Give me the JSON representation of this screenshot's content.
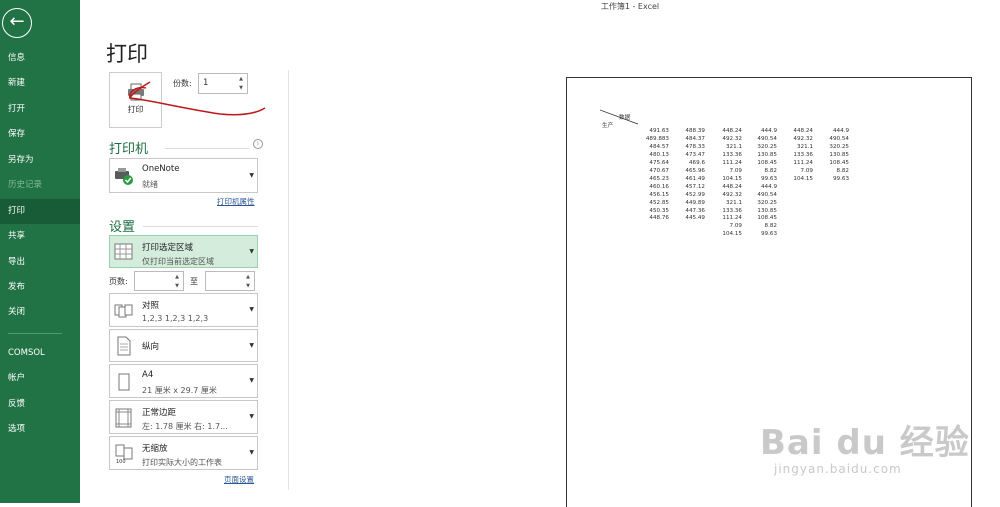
{
  "window": {
    "title": "工作簿1  -  Excel"
  },
  "sidebar": {
    "items": [
      {
        "label": "信息"
      },
      {
        "label": "新建"
      },
      {
        "label": "打开"
      },
      {
        "label": "保存"
      },
      {
        "label": "另存为"
      },
      {
        "label": "历史记录"
      },
      {
        "label": "打印"
      },
      {
        "label": "共享"
      },
      {
        "label": "导出"
      },
      {
        "label": "发布"
      },
      {
        "label": "关闭"
      },
      {
        "label": "COMSOL"
      },
      {
        "label": "帐户"
      },
      {
        "label": "反馈"
      },
      {
        "label": "选项"
      }
    ],
    "active": "打印",
    "accent": "#217346"
  },
  "print": {
    "page_title": "打印",
    "print_button_label": "打印",
    "copies_label": "份数:",
    "copies_value": "1",
    "printer_heading": "打印机",
    "printer_name": "OneNote",
    "printer_status": "就绪",
    "printer_properties_link": "打印机属性",
    "settings_heading": "设置",
    "print_range": {
      "title": "打印选定区域",
      "subtitle": "仅打印当前选定区域"
    },
    "pages_label": "页数:",
    "pages_to_label": "至",
    "collate": {
      "title": "对照",
      "subtitle": "1,2,3    1,2,3    1,2,3"
    },
    "orientation": {
      "title": "纵向"
    },
    "paper": {
      "title": "A4",
      "subtitle": "21 厘米 x 29.7 厘米"
    },
    "margins": {
      "title": "正常边距",
      "subtitle": "左: 1.78 厘米    右: 1.7..."
    },
    "scaling": {
      "title": "无缩放",
      "subtitle": "打印实际大小的工作表"
    },
    "page_setup_link": "页面设置"
  },
  "preview": {
    "header_top": "数据",
    "header_bottom": "生产",
    "columns": [
      [
        "491.63",
        "489.883",
        "484.57",
        "480.13",
        "475.64",
        "470.67",
        "465.23",
        "460.16",
        "456.15",
        "452.85",
        "450.35",
        "448.76"
      ],
      [
        "488.39",
        "484.37",
        "478.33",
        "473.47",
        "469.6",
        "465.96",
        "461.49",
        "457.12",
        "452.99",
        "449.89",
        "447.36",
        "445.49"
      ],
      [
        "448.24",
        "492.32",
        "321.1",
        "133.36",
        "111.24",
        "7.09",
        "104.15",
        "448.24",
        "492.32",
        "321.1",
        "133.36",
        "111.24",
        "7.09",
        "104.15"
      ],
      [
        "444.9",
        "490.54",
        "320.25",
        "130.85",
        "108.45",
        "8.82",
        "99.63",
        "444.9",
        "490.54",
        "320.25",
        "130.85",
        "108.45",
        "8.82",
        "99.63"
      ],
      [
        "448.24",
        "492.32",
        "321.1",
        "133.36",
        "111.24",
        "7.09",
        "104.15"
      ],
      [
        "444.9",
        "490.54",
        "320.25",
        "130.85",
        "108.45",
        "8.82",
        "99.63"
      ]
    ]
  },
  "watermark": {
    "brand": "Bai du 经验",
    "url": "jingyan.baidu.com"
  }
}
